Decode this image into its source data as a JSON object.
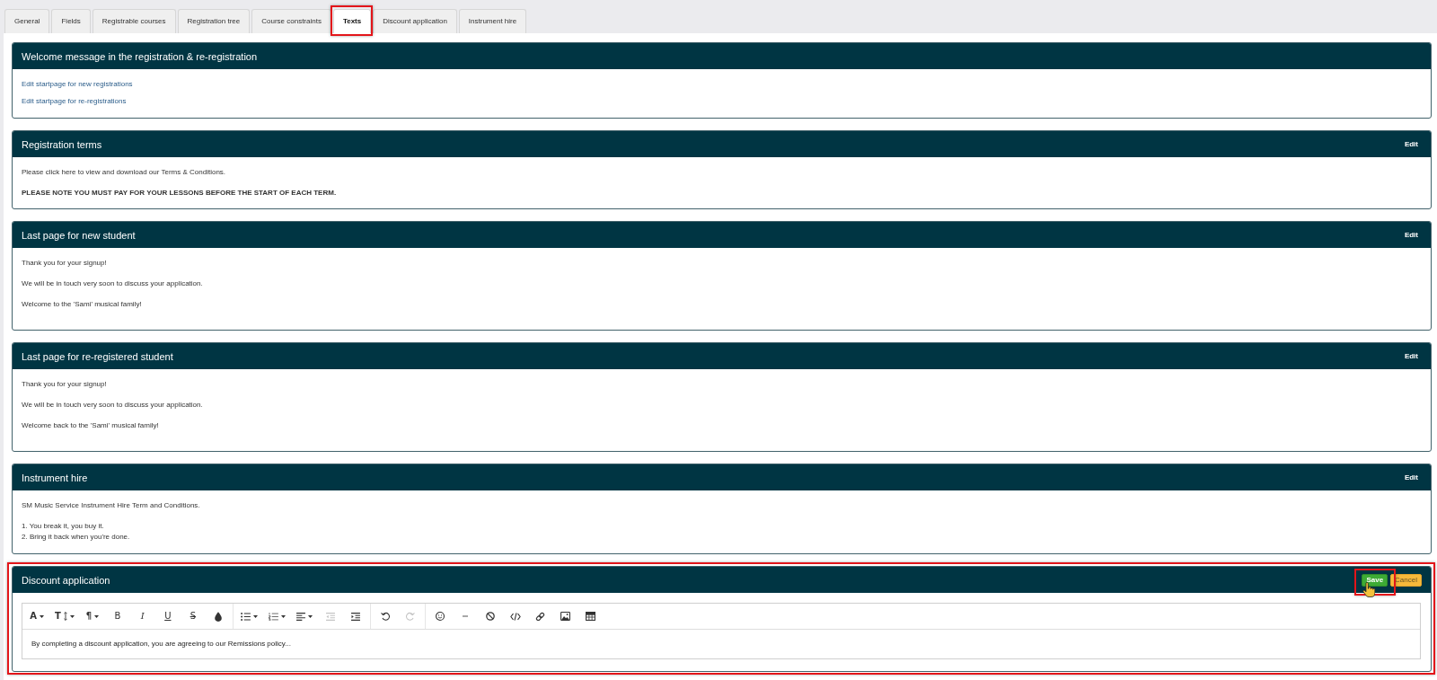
{
  "tabs": [
    {
      "label": "General",
      "selected": false,
      "highlighted": false
    },
    {
      "label": "Fields",
      "selected": false,
      "highlighted": false
    },
    {
      "label": "Registrable courses",
      "selected": false,
      "highlighted": false
    },
    {
      "label": "Registration tree",
      "selected": false,
      "highlighted": false
    },
    {
      "label": "Course constraints",
      "selected": false,
      "highlighted": false
    },
    {
      "label": "Texts",
      "selected": true,
      "highlighted": true
    },
    {
      "label": "Discount application",
      "selected": false,
      "highlighted": false
    },
    {
      "label": "Instrument hire",
      "selected": false,
      "highlighted": false
    }
  ],
  "panels": [
    {
      "kind": "links",
      "title": "Welcome message in the registration & re-registration",
      "highlighted": false,
      "links": [
        "Edit startpage for new registrations",
        "Edit startpage for re-registrations"
      ]
    },
    {
      "kind": "text",
      "title": "Registration terms",
      "highlighted": false,
      "edit_button": "Edit",
      "paragraphs": [
        {
          "lines": [
            "Please click here to view and download our Terms & Conditions."
          ],
          "bold": false
        },
        {
          "lines": [
            "PLEASE NOTE YOU MUST PAY FOR YOUR LESSONS BEFORE THE START OF EACH TERM."
          ],
          "bold": true
        }
      ]
    },
    {
      "kind": "text",
      "title": "Last page for new student",
      "highlighted": false,
      "edit_button": "Edit",
      "paragraphs": [
        {
          "lines": [
            "Thank you for your signup!"
          ],
          "bold": false
        },
        {
          "lines": [
            "We will be in touch very soon to discuss your application."
          ],
          "bold": false
        },
        {
          "lines": [
            "Welcome to the 'Sami' musical family!"
          ],
          "bold": false
        }
      ]
    },
    {
      "kind": "text",
      "title": "Last page for re-registered student",
      "highlighted": false,
      "edit_button": "Edit",
      "paragraphs": [
        {
          "lines": [
            "Thank you for your signup!"
          ],
          "bold": false
        },
        {
          "lines": [
            "We will be in touch very soon to discuss your application."
          ],
          "bold": false
        },
        {
          "lines": [
            "Welcome back to the 'Sami' musical family!"
          ],
          "bold": false
        }
      ]
    },
    {
      "kind": "text",
      "title": "Instrument hire",
      "highlighted": false,
      "edit_button": "Edit",
      "paragraphs": [
        {
          "lines": [
            "SM Music Service Instrument Hire Term and Conditions."
          ],
          "bold": false
        },
        {
          "lines": [
            "1. You break it, you buy it.",
            "2. Bring it back when you're done."
          ],
          "bold": false
        }
      ]
    },
    {
      "kind": "editor",
      "title": "Discount application",
      "highlighted": true,
      "buttons": [
        {
          "kind": "save",
          "label": "Save",
          "highlighted": true,
          "hovered": true
        },
        {
          "kind": "cancel",
          "label": "Cancel",
          "highlighted": false,
          "hovered": false
        }
      ],
      "editor": {
        "toolbar": [
          [
            {
              "kind": "font",
              "glyph": "A",
              "dropdown": true,
              "disabled": false
            },
            {
              "kind": "font-size",
              "glyph": "T",
              "dropdown": true,
              "disabled": false
            },
            {
              "kind": "paragraph",
              "glyph": "¶",
              "dropdown": true,
              "disabled": false
            },
            {
              "kind": "bold",
              "glyph": "B",
              "dropdown": false,
              "disabled": false
            },
            {
              "kind": "italic",
              "glyph": "I",
              "dropdown": false,
              "disabled": false
            },
            {
              "kind": "underline",
              "glyph": "U",
              "dropdown": false,
              "disabled": false
            },
            {
              "kind": "strikethrough",
              "glyph": "S",
              "dropdown": false,
              "disabled": false
            },
            {
              "kind": "color",
              "dropdown": false,
              "disabled": false
            }
          ],
          [
            {
              "kind": "bullet-list",
              "dropdown": true,
              "disabled": false
            },
            {
              "kind": "numbered-list",
              "dropdown": true,
              "disabled": false
            },
            {
              "kind": "align",
              "dropdown": true,
              "disabled": false
            },
            {
              "kind": "outdent",
              "dropdown": false,
              "disabled": true
            },
            {
              "kind": "indent",
              "dropdown": false,
              "disabled": false
            }
          ],
          [
            {
              "kind": "undo",
              "dropdown": false,
              "disabled": false
            },
            {
              "kind": "redo",
              "dropdown": false,
              "disabled": true
            }
          ],
          [
            {
              "kind": "emoji",
              "dropdown": false,
              "disabled": false
            },
            {
              "kind": "horizontal-rule",
              "dropdown": false,
              "disabled": false
            },
            {
              "kind": "clear-format",
              "dropdown": false,
              "disabled": false
            },
            {
              "kind": "code",
              "dropdown": false,
              "disabled": false
            },
            {
              "kind": "link",
              "dropdown": false,
              "disabled": false
            },
            {
              "kind": "image",
              "dropdown": false,
              "disabled": false
            },
            {
              "kind": "table",
              "dropdown": false,
              "disabled": false
            }
          ]
        ],
        "content": "By completing a discount application, you are agreeing to our Remissions policy..."
      }
    }
  ]
}
